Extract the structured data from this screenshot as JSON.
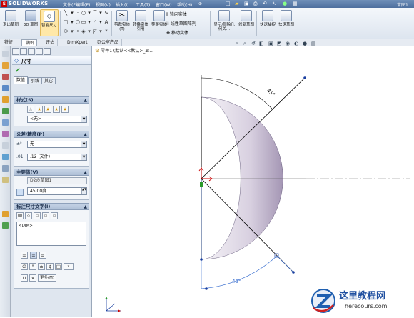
{
  "app": {
    "name": "SOLIDWORKS"
  },
  "menu": [
    "文件(F)",
    "编辑(E)",
    "视图(V)",
    "插入(I)",
    "工具(T)",
    "窗口(W)",
    "帮助(H)"
  ],
  "window_title_right": "草图1",
  "toolbar": {
    "exit_sketch": "退出草图",
    "sketch_3d": "3D 草图",
    "smart_dim": "智能尺寸",
    "trim": "剪裁实体(T)",
    "convert": "转换实体引用",
    "offset": "等距实体",
    "mirror": "镜向实体",
    "linear_pattern": "线性草图阵列",
    "move": "移动实体",
    "display_relations": "显示/删除几何关...",
    "repair": "修复草图",
    "quick_snaps": "快速捕捉",
    "rapid_sketch": "快速草图"
  },
  "tabs": [
    "特征",
    "草图",
    "评估",
    "DimXpert",
    "办公室产品"
  ],
  "active_tab": "草图",
  "feature_tree": {
    "part": "零件1 (默认<<默认>_显..."
  },
  "property_manager": {
    "title": "尺寸",
    "sub_tabs": [
      "数值",
      "引线",
      "其它"
    ],
    "style": {
      "header": "样式(S)",
      "value": "<无>"
    },
    "tolerance": {
      "header": "公差/精度(P)",
      "tolerance_type": "无",
      "precision": ".12 (文件)"
    },
    "primary_value": {
      "header": "主要值(V)",
      "name": "D2@草图1",
      "value": "45.00度"
    },
    "dim_text": {
      "header": "标注尺寸文字(I)",
      "text": "<DIM>",
      "more": "更多(M)"
    }
  },
  "graphics": {
    "dimension_top": "45°",
    "dimension_bottom": "45°",
    "accent_color": "#3a6fd0",
    "sketch_color": "#000000"
  },
  "watermark": {
    "title": "这里教程网",
    "url": "herecours.com"
  }
}
